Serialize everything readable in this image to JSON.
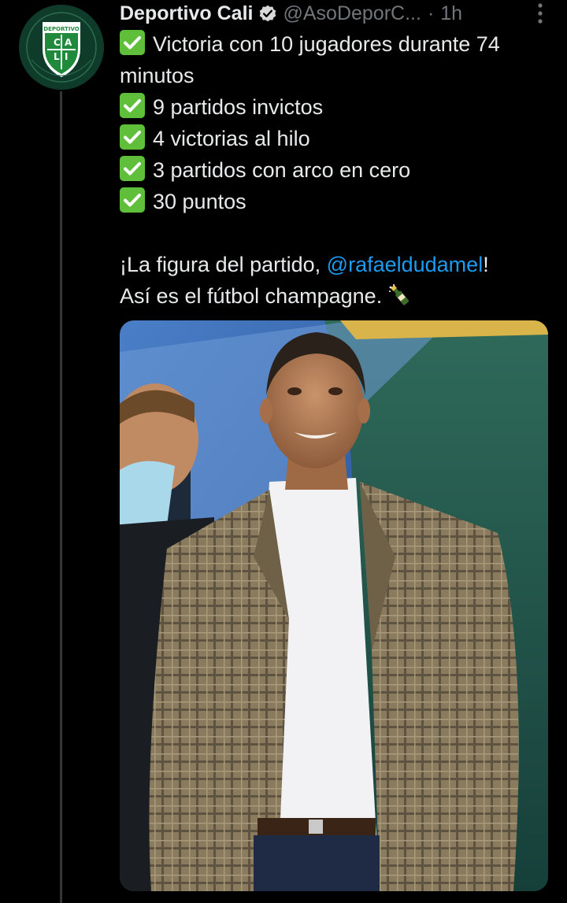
{
  "tweet": {
    "author": {
      "display_name": "Deportivo Cali",
      "handle": "@AsoDeporC...",
      "verified": true,
      "avatar_name": "deportivo-cali-crest"
    },
    "separator": "·",
    "time": "1h",
    "lines": [
      "Victoria con 10 jugadores durante 74",
      "minutos",
      "9 partidos invictos",
      "4 victorias al hilo",
      "3 partidos con arco en cero",
      "30 puntos"
    ],
    "figura_prefix": "¡La figura del partido, ",
    "mention": "@rafaeldudamel",
    "figura_suffix": "!",
    "closing": "Así es el fútbol champagne.",
    "emoji": "champagne-bottle-icon",
    "media": {
      "name": "photo-coach-plaid-blazer"
    }
  },
  "colors": {
    "background": "#000000",
    "text": "#e7e9ea",
    "secondary": "#71767b",
    "link": "#1d9bf0",
    "check": "#5fbf3a",
    "thread": "#333639"
  }
}
